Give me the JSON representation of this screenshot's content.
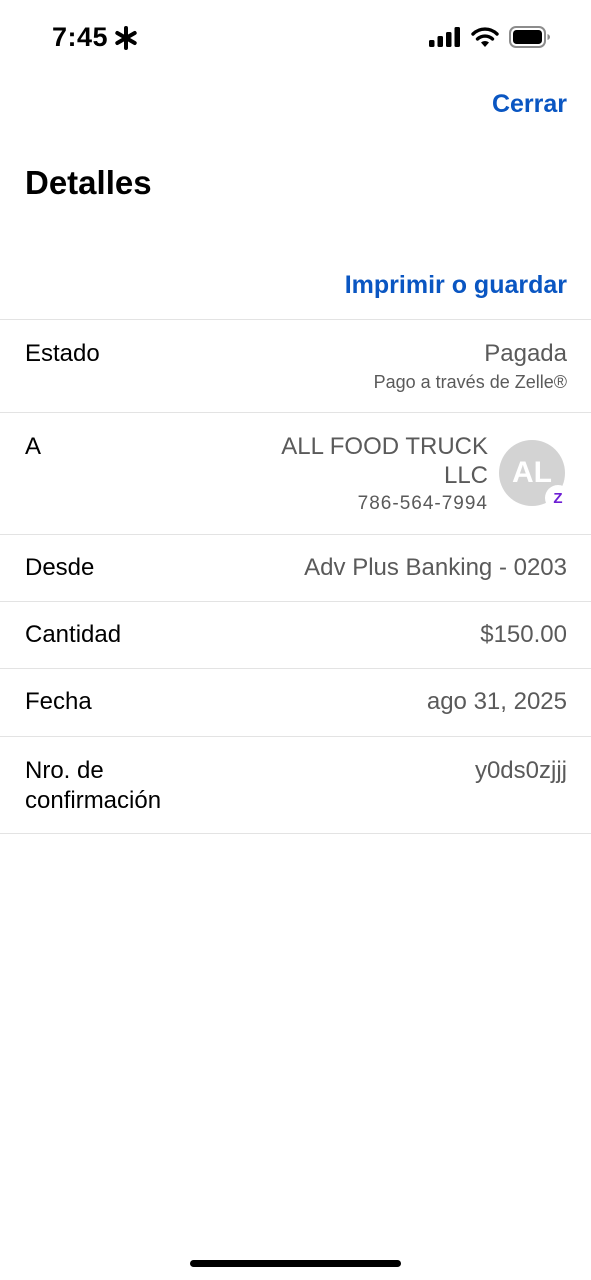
{
  "status_bar": {
    "time": "7:45",
    "time_icon": "asterisk-icon",
    "icons": [
      "signal-icon",
      "wifi-icon",
      "battery-icon"
    ]
  },
  "header": {
    "close_label": "Cerrar",
    "title": "Detalles",
    "print_label": "Imprimir o guardar"
  },
  "details": {
    "estado": {
      "label": "Estado",
      "value": "Pagada",
      "sub": "Pago a través de Zelle®"
    },
    "recipient": {
      "label": "A",
      "name_line1": "ALL FOOD TRUCK",
      "name_line2": "LLC",
      "phone": "786-564-7994",
      "avatar_initials": "AL",
      "badge_icon": "zelle-icon",
      "badge_glyph": "Z"
    },
    "desde": {
      "label": "Desde",
      "value": "Adv Plus Banking - 0203"
    },
    "cantidad": {
      "label": "Cantidad",
      "value": "$150.00"
    },
    "fecha": {
      "label": "Fecha",
      "value": "ago 31, 2025"
    },
    "confirmacion": {
      "label_line1": "Nro. de",
      "label_line2": "confirmación",
      "value": "y0ds0zjjj"
    }
  },
  "colors": {
    "accent": "#0a56c2",
    "zelle": "#6d1ed4",
    "secondary_text": "#5a5a5a",
    "divider": "#e3e3e3"
  }
}
